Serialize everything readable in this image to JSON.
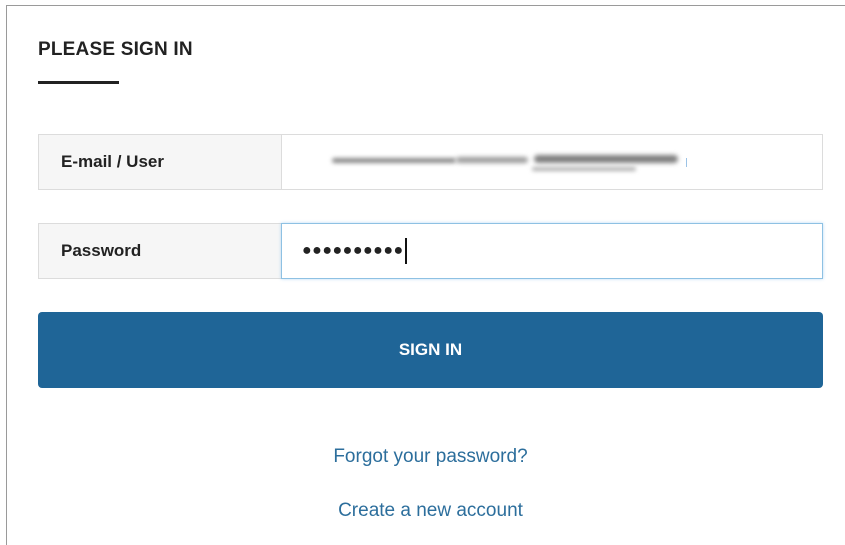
{
  "form": {
    "title": "PLEASE SIGN IN",
    "email": {
      "label": "E-mail / User",
      "value": ""
    },
    "password": {
      "label": "Password",
      "masked_value": "●●●●●●●●●●"
    },
    "submit_label": "SIGN IN"
  },
  "links": {
    "forgot_password": "Forgot your password?",
    "create_account": "Create a new account"
  },
  "colors": {
    "button_bg": "#1f6597",
    "link": "#2c6e9c",
    "label_bg": "#f6f6f6",
    "focus_border": "#8ec1e3"
  }
}
